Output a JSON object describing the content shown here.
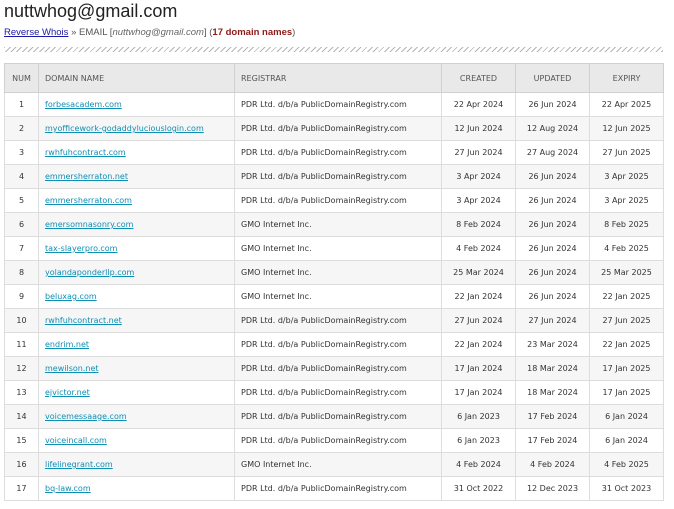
{
  "page": {
    "title": "nuttwhog@gmail.com"
  },
  "breadcrumb": {
    "link": "Reverse Whois",
    "separator": "»",
    "email_label": "EMAIL",
    "email_value": "nuttwhog@gmail.com",
    "count_text": "17 domain names"
  },
  "table": {
    "headers": [
      "NUM",
      "DOMAIN NAME",
      "REGISTRAR",
      "CREATED",
      "UPDATED",
      "EXPIRY"
    ],
    "rows": [
      {
        "num": "1",
        "domain": "forbesacadem.com",
        "registrar": "PDR Ltd. d/b/a PublicDomainRegistry.com",
        "created": "22 Apr 2024",
        "updated": "26 Jun 2024",
        "expiry": "22 Apr 2025"
      },
      {
        "num": "2",
        "domain": "myofficework-godaddyluciouslogin.com",
        "registrar": "PDR Ltd. d/b/a PublicDomainRegistry.com",
        "created": "12 Jun 2024",
        "updated": "12 Aug 2024",
        "expiry": "12 Jun 2025"
      },
      {
        "num": "3",
        "domain": "rwhfuhcontract.com",
        "registrar": "PDR Ltd. d/b/a PublicDomainRegistry.com",
        "created": "27 Jun 2024",
        "updated": "27 Aug 2024",
        "expiry": "27 Jun 2025"
      },
      {
        "num": "4",
        "domain": "emmersherraton.net",
        "registrar": "PDR Ltd. d/b/a PublicDomainRegistry.com",
        "created": "3 Apr 2024",
        "updated": "26 Jun 2024",
        "expiry": "3 Apr 2025"
      },
      {
        "num": "5",
        "domain": "emmersherraton.com",
        "registrar": "PDR Ltd. d/b/a PublicDomainRegistry.com",
        "created": "3 Apr 2024",
        "updated": "26 Jun 2024",
        "expiry": "3 Apr 2025"
      },
      {
        "num": "6",
        "domain": "emersomnasonry.com",
        "registrar": "GMO Internet Inc.",
        "created": "8 Feb 2024",
        "updated": "26 Jun 2024",
        "expiry": "8 Feb 2025"
      },
      {
        "num": "7",
        "domain": "tax-slayerpro.com",
        "registrar": "GMO Internet Inc.",
        "created": "4 Feb 2024",
        "updated": "26 Jun 2024",
        "expiry": "4 Feb 2025"
      },
      {
        "num": "8",
        "domain": "yolandaponderllp.com",
        "registrar": "GMO Internet Inc.",
        "created": "25 Mar 2024",
        "updated": "26 Jun 2024",
        "expiry": "25 Mar 2025"
      },
      {
        "num": "9",
        "domain": "beluxag.com",
        "registrar": "GMO Internet Inc.",
        "created": "22 Jan 2024",
        "updated": "26 Jun 2024",
        "expiry": "22 Jan 2025"
      },
      {
        "num": "10",
        "domain": "rwhfuhcontract.net",
        "registrar": "PDR Ltd. d/b/a PublicDomainRegistry.com",
        "created": "27 Jun 2024",
        "updated": "27 Jun 2024",
        "expiry": "27 Jun 2025"
      },
      {
        "num": "11",
        "domain": "endrim.net",
        "registrar": "PDR Ltd. d/b/a PublicDomainRegistry.com",
        "created": "22 Jan 2024",
        "updated": "23 Mar 2024",
        "expiry": "22 Jan 2025"
      },
      {
        "num": "12",
        "domain": "mewilson.net",
        "registrar": "PDR Ltd. d/b/a PublicDomainRegistry.com",
        "created": "17 Jan 2024",
        "updated": "18 Mar 2024",
        "expiry": "17 Jan 2025"
      },
      {
        "num": "13",
        "domain": "ejvictor.net",
        "registrar": "PDR Ltd. d/b/a PublicDomainRegistry.com",
        "created": "17 Jan 2024",
        "updated": "18 Mar 2024",
        "expiry": "17 Jan 2025"
      },
      {
        "num": "14",
        "domain": "voicemessaage.com",
        "registrar": "PDR Ltd. d/b/a PublicDomainRegistry.com",
        "created": "6 Jan 2023",
        "updated": "17 Feb 2024",
        "expiry": "6 Jan 2024"
      },
      {
        "num": "15",
        "domain": "voiceincall.com",
        "registrar": "PDR Ltd. d/b/a PublicDomainRegistry.com",
        "created": "6 Jan 2023",
        "updated": "17 Feb 2024",
        "expiry": "6 Jan 2024"
      },
      {
        "num": "16",
        "domain": "lifelinegrant.com",
        "registrar": "GMO Internet Inc.",
        "created": "4 Feb 2024",
        "updated": "4 Feb 2024",
        "expiry": "4 Feb 2025"
      },
      {
        "num": "17",
        "domain": "bq-law.com",
        "registrar": "PDR Ltd. d/b/a PublicDomainRegistry.com",
        "created": "31 Oct 2022",
        "updated": "12 Dec 2023",
        "expiry": "31 Oct 2023"
      }
    ]
  }
}
